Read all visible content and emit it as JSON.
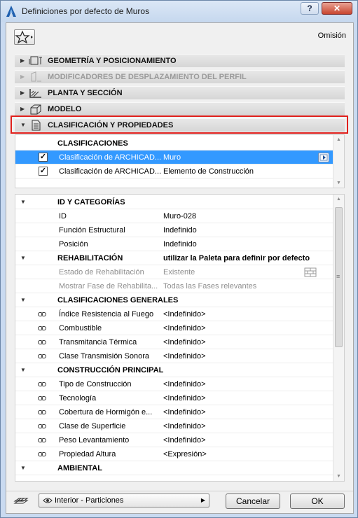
{
  "window": {
    "title": "Definiciones por defecto de Muros",
    "help_label": "?",
    "close_label": "✕"
  },
  "header": {
    "favorites_icon": "star-icon",
    "default_label": "Omisión"
  },
  "sections": [
    {
      "label": "GEOMETRÍA Y POSICIONAMIENTO",
      "expanded": false,
      "disabled": false
    },
    {
      "label": "MODIFICADORES DE DESPLAZAMIENTO DEL PERFIL",
      "expanded": false,
      "disabled": true
    },
    {
      "label": "PLANTA Y SECCIÓN",
      "expanded": false,
      "disabled": false
    },
    {
      "label": "MODELO",
      "expanded": false,
      "disabled": false
    },
    {
      "label": "CLASIFICACIÓN Y PROPIEDADES",
      "expanded": true,
      "disabled": false
    }
  ],
  "classifications": {
    "header": "CLASIFICACIONES",
    "rows": [
      {
        "name": "Clasificación de ARCHICAD...",
        "value": "Muro",
        "checked": true,
        "selected": true
      },
      {
        "name": "Clasificación de ARCHICAD...",
        "value": "Elemento de Construcción",
        "checked": true,
        "selected": false
      }
    ]
  },
  "properties": {
    "rows": [
      {
        "type": "group",
        "label": "ID Y CATEGORÍAS",
        "value": ""
      },
      {
        "type": "item",
        "label": "ID",
        "value": "Muro-028",
        "link": false,
        "disabled": false
      },
      {
        "type": "item",
        "label": "Función Estructural",
        "value": "Indefinido",
        "link": false,
        "disabled": false
      },
      {
        "type": "item",
        "label": "Posición",
        "value": "Indefinido",
        "link": false,
        "disabled": false
      },
      {
        "type": "group",
        "label": "REHABILITACIÓN",
        "value": "utilizar la Paleta para definir por defecto"
      },
      {
        "type": "item",
        "label": "Estado de Rehabilitación",
        "value": "Existente",
        "link": false,
        "disabled": true
      },
      {
        "type": "item",
        "label": "Mostrar Fase de Rehabilita...",
        "value": "Todas las Fases relevantes",
        "link": false,
        "disabled": true
      },
      {
        "type": "group",
        "label": "CLASIFICACIONES GENERALES",
        "value": ""
      },
      {
        "type": "item",
        "label": "Índice Resistencia al Fuego",
        "value": "<Indefinido>",
        "link": true,
        "disabled": false
      },
      {
        "type": "item",
        "label": "Combustible",
        "value": "<Indefinido>",
        "link": true,
        "disabled": false
      },
      {
        "type": "item",
        "label": "Transmitancia Térmica",
        "value": "<Indefinido>",
        "link": true,
        "disabled": false
      },
      {
        "type": "item",
        "label": "Clase Transmisión Sonora",
        "value": "<Indefinido>",
        "link": true,
        "disabled": false
      },
      {
        "type": "group",
        "label": "CONSTRUCCIÓN PRINCIPAL",
        "value": ""
      },
      {
        "type": "item",
        "label": "Tipo de Construcción",
        "value": "<Indefinido>",
        "link": true,
        "disabled": false
      },
      {
        "type": "item",
        "label": "Tecnología",
        "value": "<Indefinido>",
        "link": true,
        "disabled": false
      },
      {
        "type": "item",
        "label": "Cobertura de Hormigón e...",
        "value": "<Indefinido>",
        "link": true,
        "disabled": false
      },
      {
        "type": "item",
        "label": "Clase de Superficie",
        "value": "<Indefinido>",
        "link": true,
        "disabled": false
      },
      {
        "type": "item",
        "label": "Peso Levantamiento",
        "value": "<Indefinido>",
        "link": true,
        "disabled": false
      },
      {
        "type": "item",
        "label": "Propiedad Altura",
        "value": "<Expresión>",
        "link": true,
        "disabled": false
      },
      {
        "type": "group",
        "label": "AMBIENTAL",
        "value": ""
      }
    ]
  },
  "footer": {
    "layer_icon": "layer-icon",
    "view_combo": "Interior - Particiones",
    "cancel_label": "Cancelar",
    "ok_label": "OK"
  },
  "colors": {
    "selection": "#3399ff",
    "highlight_border": "#e0201c",
    "title_bg": "#c9daf0"
  }
}
